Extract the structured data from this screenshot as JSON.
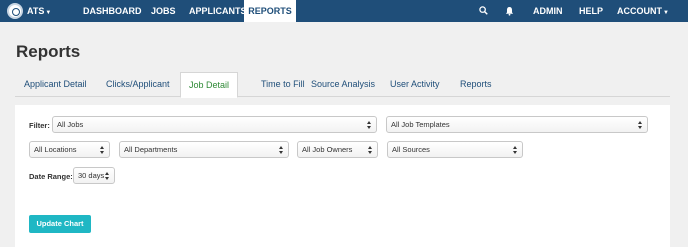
{
  "topnav": {
    "brand": "ATS",
    "items": [
      {
        "label": "DASHBOARD"
      },
      {
        "label": "JOBS"
      },
      {
        "label": "APPLICANTS"
      },
      {
        "label": "REPORTS"
      }
    ],
    "right": {
      "admin": "ADMIN",
      "help": "HELP",
      "account": "ACCOUNT"
    },
    "icons": {
      "search": "search-icon",
      "notifications": "bell-icon"
    },
    "colors": {
      "bar": "#1f4e79",
      "active_bg": "#ffffff"
    }
  },
  "page": {
    "title": "Reports"
  },
  "tabs": [
    {
      "label": "Applicant Detail"
    },
    {
      "label": "Clicks/Applicant"
    },
    {
      "label": "Job Detail"
    },
    {
      "label": "Time to Fill"
    },
    {
      "label": "Source Analysis"
    },
    {
      "label": "User Activity"
    },
    {
      "label": "Reports"
    }
  ],
  "active_tab": "Job Detail",
  "filters": {
    "filter_label": "Filter:",
    "jobs": "All Jobs",
    "job_templates": "All Job Templates",
    "locations": "All Locations",
    "departments": "All Departments",
    "job_owners": "All Job Owners",
    "sources": "All Sources",
    "date_range_label": "Date Range:",
    "date_range": "30 days"
  },
  "actions": {
    "update_chart": "Update Chart"
  },
  "colors": {
    "accent": "#1fb7c4",
    "active_tab_text": "#2f8a36",
    "link": "#1f4e79"
  }
}
